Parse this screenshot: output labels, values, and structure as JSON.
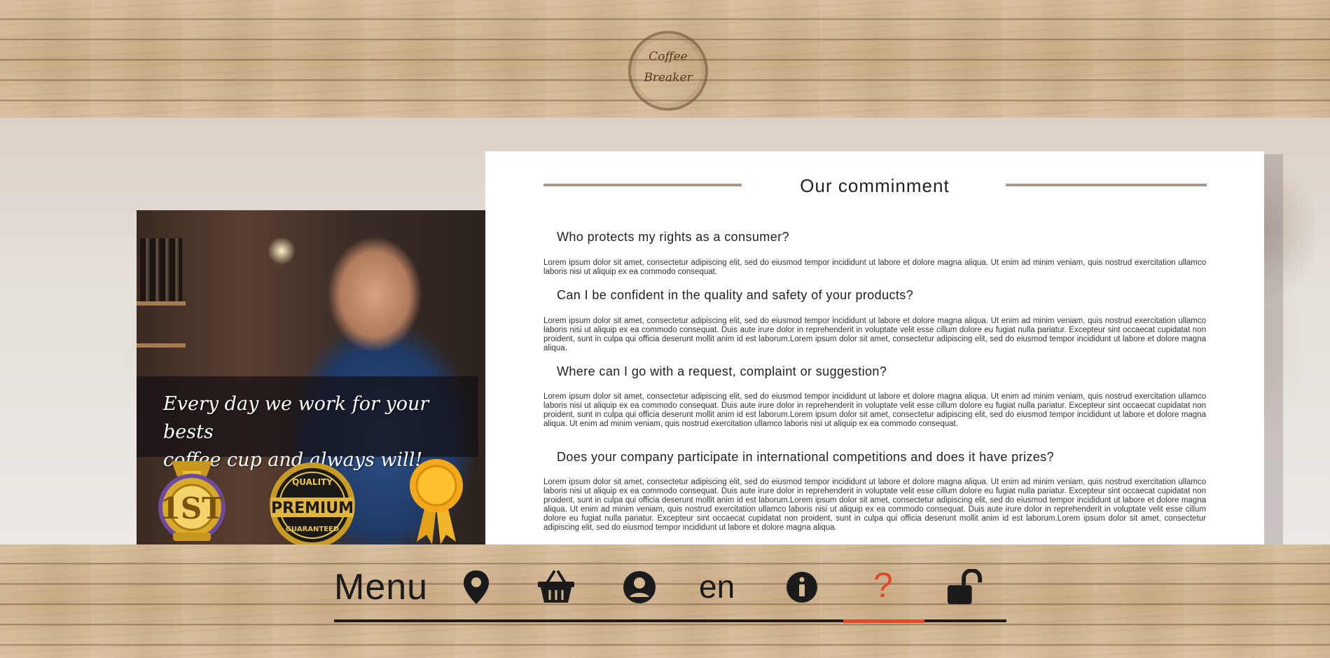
{
  "brand": {
    "line1": "Coffee",
    "line2": "Breaker"
  },
  "promo": {
    "caption_line1": "Every day we work for your bests",
    "caption_line2": "coffee cup and always will!",
    "badges": [
      {
        "icon": "first-place-medal-icon",
        "text": "1ST"
      },
      {
        "icon": "quality-premium-seal-icon",
        "top": "QUALITY",
        "main": "PREMIUM",
        "bottom": "GUARANTEED"
      },
      {
        "icon": "award-ribbon-icon"
      }
    ]
  },
  "faq": {
    "title": "Our comminment",
    "items": [
      {
        "question": "Who protects my rights as a consumer?",
        "answer": "Lorem ipsum dolor sit amet, consectetur adipiscing elit, sed do eiusmod tempor incididunt ut labore et dolore magna aliqua. Ut enim ad minim veniam, quis nostrud exercitation ullamco laboris nisi ut aliquip ex ea commodo consequat."
      },
      {
        "question": "Can I be confident in the quality and safety of your products?",
        "answer": "Lorem ipsum dolor sit amet, consectetur adipiscing elit, sed do eiusmod tempor incididunt ut labore et dolore magna aliqua. Ut enim ad minim veniam, quis nostrud exercitation ullamco laboris nisi ut aliquip ex ea commodo consequat. Duis aute irure dolor in reprehenderit in voluptate velit esse cillum dolore eu fugiat nulla pariatur. Excepteur sint occaecat cupidatat non proident, sunt in culpa qui officia deserunt mollit anim id est laborum.Lorem ipsum dolor sit amet, consectetur adipiscing elit, sed do eiusmod tempor incididunt ut labore et dolore magna aliqua."
      },
      {
        "question": "Where can I go with a request, complaint or suggestion?",
        "answer": "Lorem ipsum dolor sit amet, consectetur adipiscing elit, sed do eiusmod tempor incididunt ut labore et dolore magna aliqua. Ut enim ad minim veniam, quis nostrud exercitation ullamco laboris nisi ut aliquip ex ea commodo consequat. Duis aute irure dolor in reprehenderit in voluptate velit esse cillum dolore eu fugiat nulla pariatur. Excepteur sint occaecat cupidatat non proident, sunt in culpa qui officia deserunt mollit anim id est laborum.Lorem ipsum dolor sit amet, consectetur adipiscing elit, sed do eiusmod tempor incididunt ut labore et dolore magna aliqua. Ut enim ad minim veniam, quis nostrud exercitation ullamco laboris nisi ut aliquip ex ea commodo consequat."
      },
      {
        "question": "Does your company participate in international competitions and does it have prizes?",
        "answer": "Lorem ipsum dolor sit amet, consectetur adipiscing elit, sed do eiusmod tempor incididunt ut labore et dolore magna aliqua. Ut enim ad minim veniam, quis nostrud exercitation ullamco laboris nisi ut aliquip ex ea commodo consequat. Duis aute irure dolor in reprehenderit in voluptate velit esse cillum dolore eu fugiat nulla pariatur. Excepteur sint occaecat cupidatat non proident, sunt in culpa qui officia deserunt mollit anim id est laborum.Lorem ipsum dolor sit amet, consectetur adipiscing elit, sed do eiusmod tempor incididunt ut labore et dolore magna aliqua. Ut enim ad minim veniam, quis nostrud exercitation ullamco laboris nisi ut aliquip ex ea commodo consequat. Duis aute irure dolor in reprehenderit in voluptate velit esse cillum dolore eu fugiat nulla pariatur. Excepteur sint occaecat cupidatat non proident, sunt in culpa qui officia deserunt mollit anim id est laborum.Lorem ipsum dolor sit amet, consectetur adipiscing elit, sed do eiusmod tempor incididunt ut labore et dolore magna aliqua."
      }
    ]
  },
  "nav": {
    "menu_label": "Menu",
    "language": "en",
    "help_label": "?",
    "icons": [
      "location-pin-icon",
      "basket-icon",
      "user-account-icon",
      "info-icon",
      "unlocked-padlock-icon"
    ],
    "accent": "#e04a28",
    "active_item": "help"
  }
}
